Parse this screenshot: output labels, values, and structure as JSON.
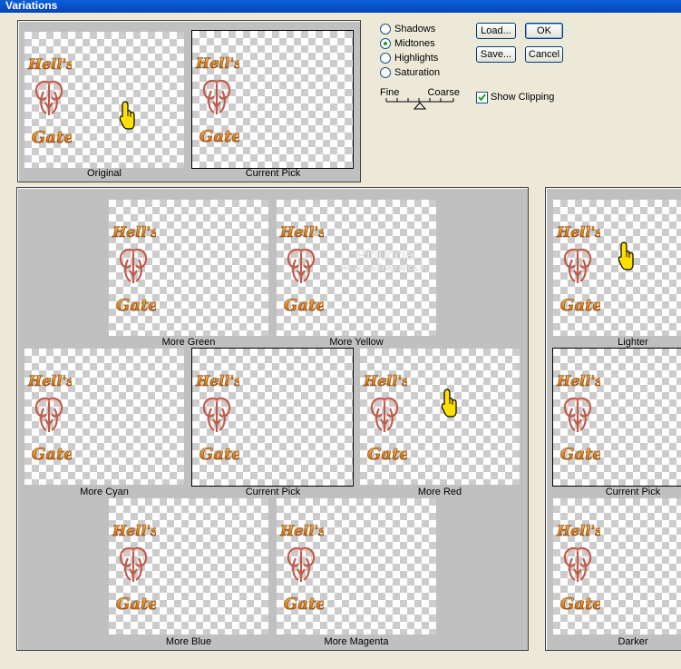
{
  "window": {
    "title": "Variations"
  },
  "preview": {
    "original_caption": "Original",
    "current_pick_caption": "Current Pick"
  },
  "tone_options": [
    {
      "label": "Shadows",
      "selected": false
    },
    {
      "label": "Midtones",
      "selected": true
    },
    {
      "label": "Highlights",
      "selected": false
    },
    {
      "label": "Saturation",
      "selected": false
    }
  ],
  "buttons": {
    "load": "Load...",
    "save": "Save...",
    "ok": "OK",
    "cancel": "Cancel"
  },
  "slider": {
    "fine_label": "Fine",
    "coarse_label": "Coarse",
    "position": 0.5
  },
  "show_clipping": {
    "label": "Show Clipping",
    "checked": true
  },
  "hue_grid": {
    "more_green": "More Green",
    "more_yellow": "More Yellow",
    "more_cyan": "More Cyan",
    "current_pick": "Current Pick",
    "more_red": "More Red",
    "more_blue": "More Blue",
    "more_magenta": "More Magenta"
  },
  "brightness": {
    "lighter": "Lighter",
    "current_pick": "Current Pick",
    "darker": "Darker"
  },
  "watermark": {
    "line1": "Pinuccia",
    "line2": "www.madiregrafica.eu"
  },
  "artwork": {
    "word_top": "Hell's",
    "word_bottom": "Gate"
  },
  "colors": {
    "panel": "#c0c0c0",
    "dialog": "#ece9d8",
    "titlebar": "#0a5fd8",
    "art_gold": "#e08a1a",
    "hand": "#ffe000"
  }
}
